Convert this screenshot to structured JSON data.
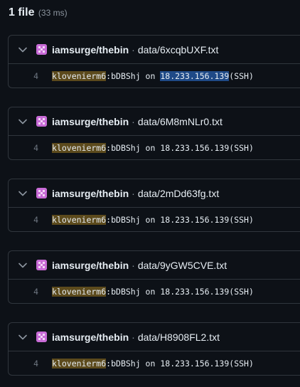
{
  "summary": {
    "count_label": "1 file",
    "timing": "(33 ms)"
  },
  "results": [
    {
      "repo": "iamsurge/thebin",
      "separator": "·",
      "path": "data/6xcqbUXF.txt",
      "line_number": "4",
      "match": "klovenierm6",
      "rest_before_ip": ":bDBShj on ",
      "ip": "18.233.156.139",
      "suffix": "(SSH)"
    },
    {
      "repo": "iamsurge/thebin",
      "separator": "·",
      "path": "data/6M8mNLr0.txt",
      "line_number": "4",
      "match": "klovenierm6",
      "rest_before_ip": ":bDBShj on ",
      "ip": "18.233.156.139",
      "suffix": "(SSH)"
    },
    {
      "repo": "iamsurge/thebin",
      "separator": "·",
      "path": "data/2mDd63fg.txt",
      "line_number": "4",
      "match": "klovenierm6",
      "rest_before_ip": ":bDBShj on ",
      "ip": "18.233.156.139",
      "suffix": "(SSH)"
    },
    {
      "repo": "iamsurge/thebin",
      "separator": "·",
      "path": "data/9yGW5CVE.txt",
      "line_number": "4",
      "match": "klovenierm6",
      "rest_before_ip": ":bDBShj on ",
      "ip": "18.233.156.139",
      "suffix": "(SSH)"
    },
    {
      "repo": "iamsurge/thebin",
      "separator": "·",
      "path": "data/H8908FL2.txt",
      "line_number": "4",
      "match": "klovenierm6",
      "rest_before_ip": ":bDBShj on ",
      "ip": "18.233.156.139",
      "suffix": "(SSH)"
    }
  ],
  "icons": {
    "chevron": "chevron-down-icon",
    "avatar": "repo-avatar"
  },
  "colors": {
    "background": "#0d1117",
    "border": "#30363d",
    "match_highlight": "#5c4a1c",
    "selection": "#1f4a87",
    "avatar": "#c86bd6"
  }
}
